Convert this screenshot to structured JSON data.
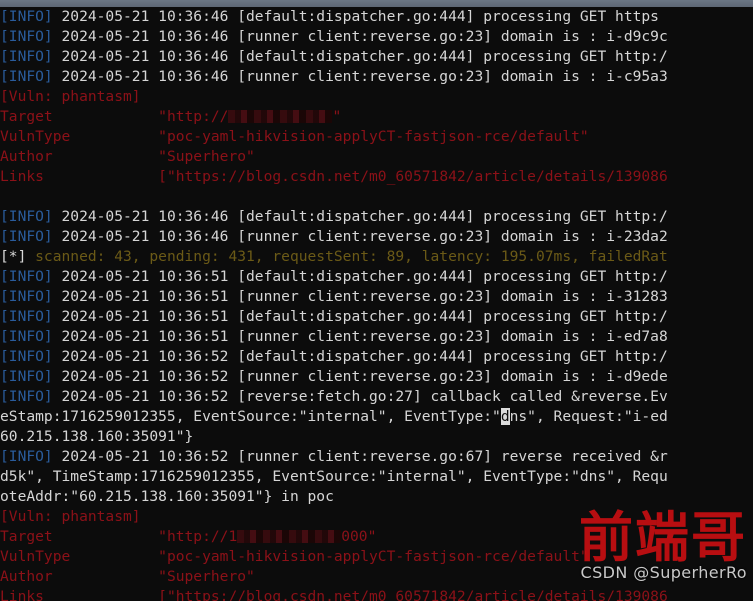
{
  "window": {
    "title_bar_color": "#5d6774",
    "background": "#0c0c0c"
  },
  "colors": {
    "info_tag": "#2a5c9c",
    "log_text": "#d6d6d6",
    "stat_text": "#6b5a17",
    "stat_number": "#8a7420",
    "vuln_text": "#8c1118",
    "cursor_bg": "#dcdcdc",
    "watermark_red": "#c60f12",
    "watermark_gray": "#c9c9c9"
  },
  "watermark": {
    "chinese": "前端哥",
    "english": "CSDN @SuperherRo"
  },
  "tokens": {
    "info_tag": "[INFO]",
    "star_tag": "[*]",
    "date": "2024-05-21"
  },
  "lines": [
    {
      "id": "l1",
      "type": "info",
      "tag": "[INFO]",
      "text": " 2024-05-21 10:36:46 [default:dispatcher.go:444] processing GET https"
    },
    {
      "id": "l2",
      "type": "info",
      "tag": "[INFO]",
      "text": " 2024-05-21 10:36:46 [runner client:reverse.go:23] domain is : i-d9c9c"
    },
    {
      "id": "l3",
      "type": "info",
      "tag": "[INFO]",
      "text": " 2024-05-21 10:36:46 [default:dispatcher.go:444] processing GET http:/"
    },
    {
      "id": "l4",
      "type": "info",
      "tag": "[INFO]",
      "text": " 2024-05-21 10:36:46 [runner client:reverse.go:23] domain is : i-c95a3"
    },
    {
      "id": "l5",
      "type": "vuln-header",
      "text": "[Vuln: phantasm]"
    },
    {
      "id": "l6",
      "type": "vuln-target",
      "key": "Target",
      "prefix": "\"http://",
      "suffix": "\""
    },
    {
      "id": "l7",
      "type": "vuln-kv",
      "key": "VulnType",
      "value": "\"poc-yaml-hikvision-applyCT-fastjson-rce/default\""
    },
    {
      "id": "l8",
      "type": "vuln-kv",
      "key": "Author",
      "value": "\"Superhero\""
    },
    {
      "id": "l9",
      "type": "vuln-kv",
      "key": "Links",
      "value": "[\"https://blog.csdn.net/m0_60571842/article/details/139086"
    },
    {
      "id": "l10",
      "type": "blank",
      "text": ""
    },
    {
      "id": "l11",
      "type": "info",
      "tag": "[INFO]",
      "text": " 2024-05-21 10:36:46 [default:dispatcher.go:444] processing GET http:/"
    },
    {
      "id": "l12",
      "type": "info",
      "tag": "[INFO]",
      "text": " 2024-05-21 10:36:46 [runner client:reverse.go:23] domain is : i-23da2"
    },
    {
      "id": "l13",
      "type": "stat",
      "tag": "[*]",
      "text": " scanned: 43, pending: 431, requestSent: 89, latency: 195.07ms, failedRat"
    },
    {
      "id": "l14",
      "type": "info",
      "tag": "[INFO]",
      "text": " 2024-05-21 10:36:51 [default:dispatcher.go:444] processing GET http:/"
    },
    {
      "id": "l15",
      "type": "info",
      "tag": "[INFO]",
      "text": " 2024-05-21 10:36:51 [runner client:reverse.go:23] domain is : i-31283"
    },
    {
      "id": "l16",
      "type": "info",
      "tag": "[INFO]",
      "text": " 2024-05-21 10:36:51 [default:dispatcher.go:444] processing GET http:/"
    },
    {
      "id": "l17",
      "type": "info",
      "tag": "[INFO]",
      "text": " 2024-05-21 10:36:51 [runner client:reverse.go:23] domain is : i-ed7a8"
    },
    {
      "id": "l18",
      "type": "info",
      "tag": "[INFO]",
      "text": " 2024-05-21 10:36:52 [default:dispatcher.go:444] processing GET http:/"
    },
    {
      "id": "l19",
      "type": "info",
      "tag": "[INFO]",
      "text": " 2024-05-21 10:36:52 [runner client:reverse.go:23] domain is : i-d9ede"
    },
    {
      "id": "l20",
      "type": "info",
      "tag": "[INFO]",
      "text": " 2024-05-21 10:36:52 [reverse:fetch.go:27] callback called &reverse.Ev"
    },
    {
      "id": "l21",
      "type": "cursor-line",
      "before": "eStamp:1716259012355, EventSource:\"internal\", EventType:\"",
      "cursor": "d",
      "after": "ns\", Request:\"i-ed"
    },
    {
      "id": "l22",
      "type": "log",
      "text": "60.215.138.160:35091\"}"
    },
    {
      "id": "l23",
      "type": "info",
      "tag": "[INFO]",
      "text": " 2024-05-21 10:36:52 [runner client:reverse.go:67] reverse received &r"
    },
    {
      "id": "l24",
      "type": "log",
      "text": "d5k\", TimeStamp:1716259012355, EventSource:\"internal\", EventType:\"dns\", Requ"
    },
    {
      "id": "l25",
      "type": "log",
      "text": "oteAddr:\"60.215.138.160:35091\"} in poc"
    },
    {
      "id": "l26",
      "type": "vuln-header",
      "text": "[Vuln: phantasm]"
    },
    {
      "id": "l27",
      "type": "vuln-target",
      "key": "Target",
      "prefix": "\"http://1",
      "suffix": "000\""
    },
    {
      "id": "l28",
      "type": "vuln-kv",
      "key": "VulnType",
      "value": "\"poc-yaml-hikvision-applyCT-fastjson-rce/default\""
    },
    {
      "id": "l29",
      "type": "vuln-kv",
      "key": "Author",
      "value": "\"Superhero\""
    },
    {
      "id": "l30",
      "type": "vuln-kv",
      "key": "Links",
      "value": "[\"https://blog.csdn.net/m0_60571842/article/details/139086"
    }
  ]
}
